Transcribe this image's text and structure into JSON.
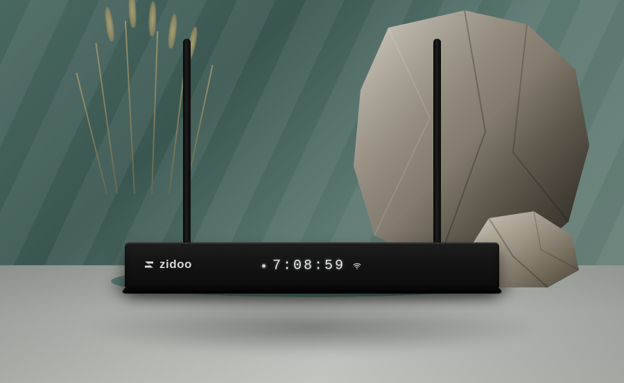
{
  "product": {
    "brand": "zidoo",
    "display_time": "7:08:59"
  }
}
